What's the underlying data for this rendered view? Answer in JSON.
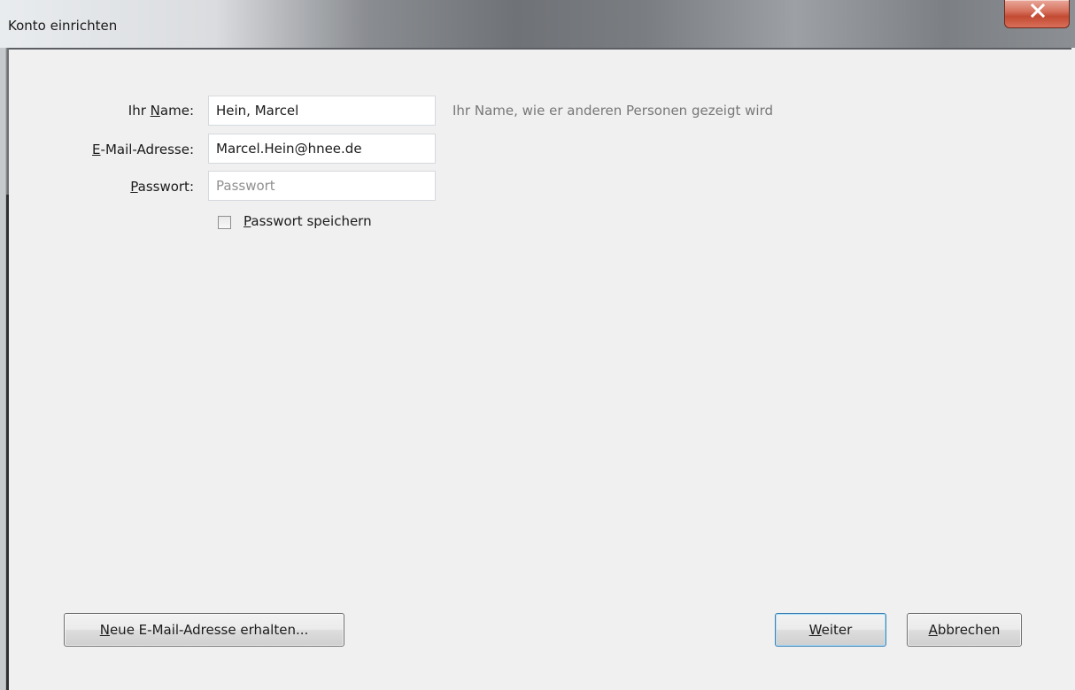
{
  "window": {
    "title": "Konto einrichten"
  },
  "form": {
    "name": {
      "label_prefix": "Ihr ",
      "label_key": "N",
      "label_rest": "ame:",
      "value": "Hein, Marcel",
      "hint": "Ihr Name, wie er anderen Personen gezeigt wird"
    },
    "email": {
      "label_key": "E",
      "label_rest": "-Mail-Adresse:",
      "value": "Marcel.Hein@hnee.de"
    },
    "password": {
      "label_key": "P",
      "label_rest": "asswort:",
      "value": "",
      "placeholder": "Passwort"
    },
    "remember": {
      "checked": false,
      "label_key": "P",
      "label_rest": "asswort speichern"
    }
  },
  "buttons": {
    "new_address": {
      "label_key": "N",
      "label_rest": "eue E-Mail-Adresse erhalten..."
    },
    "next": {
      "label_key": "W",
      "label_rest": "eiter"
    },
    "cancel": {
      "label_key": "A",
      "label_rest": "bbrechen"
    }
  },
  "icons": {
    "close": "close-icon"
  },
  "colors": {
    "close_button": "#c24a32",
    "default_button_border": "#3c7fb1",
    "hint_text": "#777777"
  }
}
